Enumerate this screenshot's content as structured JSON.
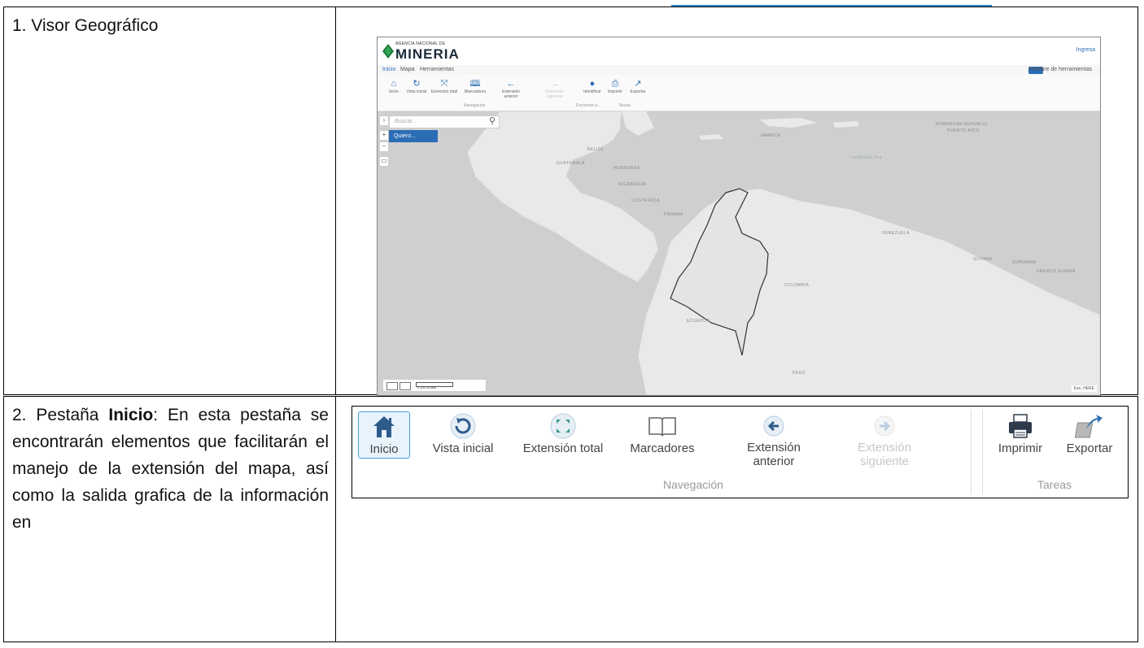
{
  "row1": {
    "caption": "1. Visor Geográfico",
    "map": {
      "logo_small": "AGENCIA NACIONAL DE",
      "logo_big": "MINERIA",
      "login": "Ingresa",
      "tabs": [
        "Inicio",
        "Mapa",
        "Herramientas"
      ],
      "toggle_label": "Nombre de herramientas",
      "tools": [
        {
          "label": "Inicio",
          "icon": "home-icon",
          "disabled": false
        },
        {
          "label": "Vista inicial",
          "icon": "refresh-icon",
          "disabled": false
        },
        {
          "label": "Extensión total",
          "icon": "expand-icon",
          "disabled": false
        },
        {
          "label": "Marcadores",
          "icon": "book-icon",
          "disabled": false
        },
        {
          "label": "Extensión anterior",
          "icon": "arrow-left-icon",
          "disabled": false
        },
        {
          "label": "Extensión siguiente",
          "icon": "arrow-right-icon",
          "disabled": true
        },
        {
          "label": "Identificar",
          "icon": "identify-icon",
          "disabled": false
        },
        {
          "label": "Imprimir",
          "icon": "printer-icon",
          "disabled": false
        },
        {
          "label": "Exportar",
          "icon": "export-icon",
          "disabled": false
        }
      ],
      "groups": [
        "Navegación",
        "Encontrar d...",
        "Tareas"
      ],
      "search_placeholder": "Buscar...",
      "quiero_button": "Quiero...",
      "scale_text": "0 200 400km",
      "attribution": "Esri, HERE",
      "labels": {
        "dominican": "DOMINICAN REPUBLIC",
        "puerto": "PUERTO RICO",
        "belize": "BELIZE",
        "guatemala": "GUATEMALA",
        "honduras": "HONDURAS",
        "nicaragua": "NICARAGUA",
        "costa": "COSTA RICA",
        "panama": "PANAMA",
        "jamaica": "JAMAICA",
        "caribbean": "Caribbean Sea",
        "venezuela": "VENEZUELA",
        "guyana": "GUYANA",
        "suriname": "SURINAME",
        "french_guiana": "FRENCH GUIANA",
        "colombia": "COLOMBIA",
        "ecuador": "ECUADOR",
        "peru": "PERÚ"
      }
    }
  },
  "row2": {
    "caption_prefix": "2. Pestaña ",
    "caption_bold": "Inicio",
    "caption_rest": ": En esta pestaña se encontrarán elementos que facilitarán el manejo de la extensión del mapa, así como la salida grafica de la información en",
    "ribbon": {
      "buttons": [
        {
          "label": "Inicio",
          "icon": "home-icon",
          "disabled": false
        },
        {
          "label": "Vista inicial",
          "icon": "refresh-icon",
          "disabled": false
        },
        {
          "label": "Extensión total",
          "icon": "expand-icon",
          "disabled": false
        },
        {
          "label": "Marcadores",
          "icon": "book-icon",
          "disabled": false
        },
        {
          "label": "Extensión anterior",
          "icon": "arrow-left-icon",
          "disabled": false
        },
        {
          "label": "Extensión siguiente",
          "icon": "arrow-right-icon",
          "disabled": true
        },
        {
          "label": "Imprimir",
          "icon": "printer-icon",
          "disabled": false
        },
        {
          "label": "Exportar",
          "icon": "export-icon",
          "disabled": false
        }
      ],
      "group_navegacion": "Navegación",
      "group_tareas": "Tareas"
    }
  },
  "colors": {
    "accent": "#2a6db5",
    "active_border": "#4a9fd8",
    "land": "#e8e8e8",
    "sea": "#c8c8c8"
  }
}
